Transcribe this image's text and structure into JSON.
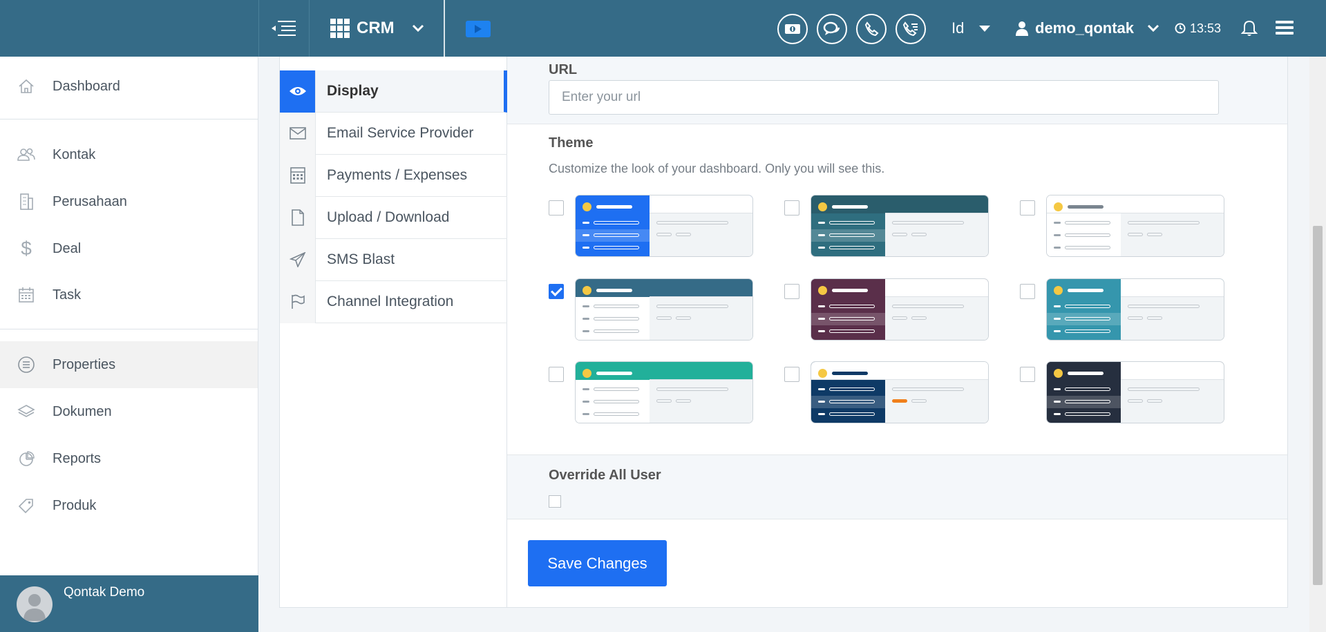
{
  "topbar": {
    "module_label": "CRM",
    "language": "Id",
    "username": "demo_qontak",
    "time": "13:53"
  },
  "sidebar": {
    "items": [
      {
        "label": "Dashboard",
        "icon": "home-icon"
      },
      {
        "label": "Kontak",
        "icon": "users-icon"
      },
      {
        "label": "Perusahaan",
        "icon": "building-icon"
      },
      {
        "label": "Deal",
        "icon": "dollar-icon"
      },
      {
        "label": "Task",
        "icon": "calendar-icon"
      },
      {
        "label": "Properties",
        "icon": "list-circle-icon",
        "active": true
      },
      {
        "label": "Dokumen",
        "icon": "layers-icon"
      },
      {
        "label": "Reports",
        "icon": "pie-chart-icon"
      },
      {
        "label": "Produk",
        "icon": "tag-icon"
      }
    ],
    "profile_name": "Qontak Demo"
  },
  "settings_nav": {
    "items": [
      {
        "label": "Display",
        "icon": "eye-icon",
        "active": true
      },
      {
        "label": "Email Service Provider",
        "icon": "envelope-icon"
      },
      {
        "label": "Payments / Expenses",
        "icon": "calculator-icon"
      },
      {
        "label": "Upload / Download",
        "icon": "file-icon"
      },
      {
        "label": "SMS Blast",
        "icon": "paper-plane-icon"
      },
      {
        "label": "Channel Integration",
        "icon": "flag-icon"
      }
    ]
  },
  "url": {
    "label": "URL",
    "placeholder": "Enter your url",
    "value": ""
  },
  "theme": {
    "label": "Theme",
    "description": "Customize the look of your dashboard. Only you will see this.",
    "options": [
      {
        "sidebar": "#1e6ff2",
        "header": "#1e6ff2",
        "selected": false
      },
      {
        "sidebar": "#2f6e7f",
        "header": "#2a5d6c",
        "selected": false
      },
      {
        "sidebar": "#ffffff",
        "header": "#ffffff",
        "selected": false
      },
      {
        "sidebar": "#ffffff",
        "header": "#356b87",
        "selected": true
      },
      {
        "sidebar": "#5a2f4a",
        "header": "#5a2f4a",
        "selected": false
      },
      {
        "sidebar": "#3596ad",
        "header": "#3596ad",
        "selected": false
      },
      {
        "sidebar": "#ffffff",
        "header": "#22b09a",
        "selected": false
      },
      {
        "sidebar": "#0e3a66",
        "header": "#ffffff",
        "selected": false
      },
      {
        "sidebar": "#262f3f",
        "header": "#262f3f",
        "selected": false
      }
    ]
  },
  "override": {
    "label": "Override All User",
    "checked": false
  },
  "save_button": {
    "label": "Save Changes"
  }
}
